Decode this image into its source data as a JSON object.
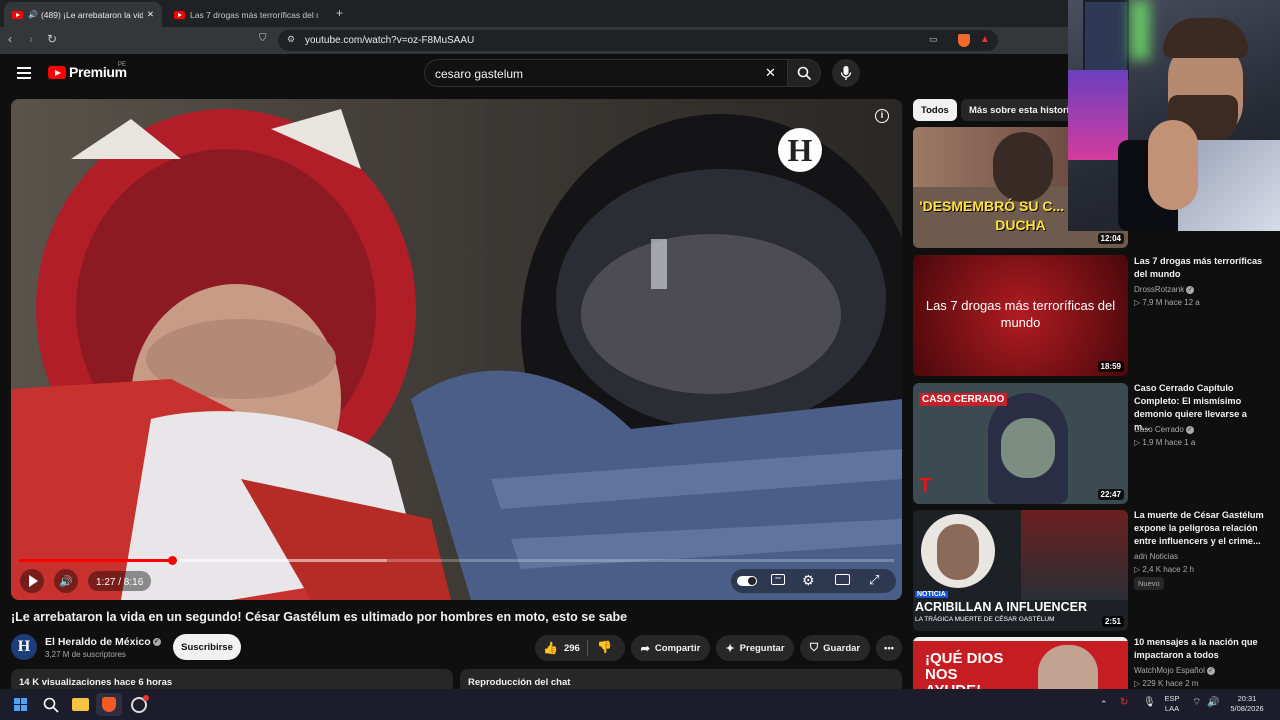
{
  "browser": {
    "tabs": [
      {
        "title": "(489) ¡Le arrebataron la vida e",
        "active": true
      },
      {
        "title": "Las 7 drogas más terroríficas del mu",
        "active": false
      }
    ],
    "url": "youtube.com/watch?v=oz-F8MuSAAU"
  },
  "header": {
    "logo_text": "Premium",
    "region": "PE",
    "search_value": "cesaro gastelum"
  },
  "player": {
    "time_label": "1:27 / 8:16",
    "progress_fraction": 0.175,
    "buffer_fraction": 0.42,
    "channel_watermark": "H"
  },
  "video": {
    "title": "¡Le arrebataron la vida en un segundo! César Gastélum es ultimado por hombres en moto, esto se sabe",
    "channel": "El Heraldo de México",
    "subscribers": "3,27 M de suscriptores",
    "subscribe_label": "Suscribirse",
    "likes": "296",
    "share_label": "Compartir",
    "ask_label": "Preguntar",
    "save_label": "Guardar",
    "views_time": "14 K visualizaciones  hace 6 horas",
    "chat_replay": "Reproducción del chat",
    "avatar_letter": "H"
  },
  "sidebar": {
    "chips": [
      "Todos",
      "Más sobre esta historia"
    ],
    "recommendations": [
      {
        "duration": "12:04",
        "thumb_text": "'DESMEMBRÓ SU C... EN UNA DUCHA"
      },
      {
        "title": "Las 7 drogas más terroríficas del mundo",
        "channel": "DrossRotzank",
        "meta": "▷ 7,9 M  hace 12 a",
        "duration": "18:59",
        "thumb_text": "Las 7 drogas más terroríficas del mundo"
      },
      {
        "title": "Caso Cerrado Capítulo Completo: El mismísimo demonio quiere llevarse a m...",
        "channel": "Caso Cerrado",
        "meta": "▷ 1,9 M  hace 1 a",
        "duration": "22:47",
        "thumb_text": "CASO CERRADO"
      },
      {
        "title": "La muerte de César Gastélum expone la peligrosa relación entre influencers y el crime...",
        "channel": "adn Noticias",
        "meta": "▷ 2,4 K  hace 2 h",
        "badge": "Nuevo",
        "duration": "2:51",
        "thumb_kicker": "NOTICIA",
        "thumb_text": "ACRIBILLAN A INFLUENCER",
        "thumb_sub": "LA TRÁGICA MUERTE DE CÉSAR GASTÉLUM"
      },
      {
        "title": "10 mensajes a la nación que impactaron a todos",
        "channel": "WatchMojo Español",
        "meta": "▷ 229 K  hace 2 m",
        "thumb_text": "¡QUÉ DIOS NOS AYUDE!"
      }
    ]
  },
  "taskbar": {
    "lang_line1": "ESP",
    "lang_line2": "LAA",
    "time": "20:31",
    "date": "5/08/2026"
  }
}
